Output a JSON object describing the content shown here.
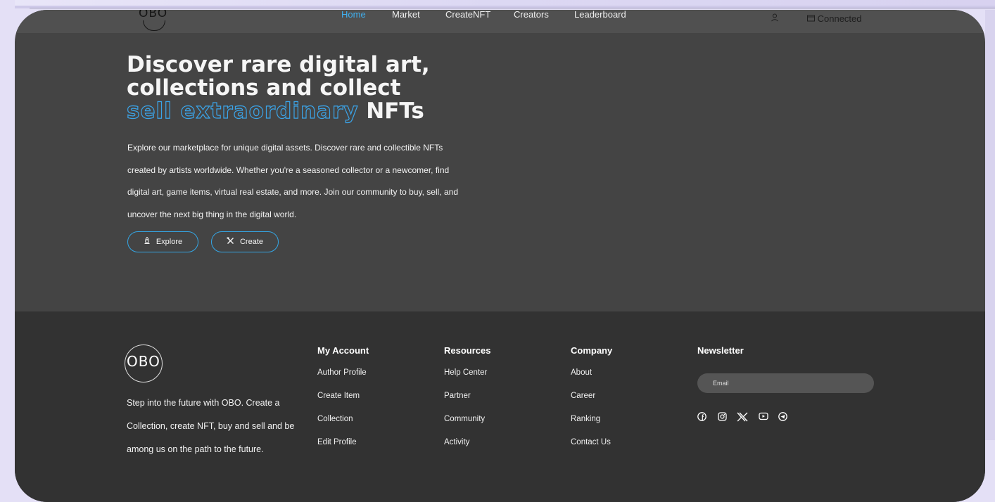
{
  "brand": {
    "logo": "OBO"
  },
  "nav": {
    "items": [
      {
        "label": "Home",
        "active": true
      },
      {
        "label": "Market",
        "active": false
      },
      {
        "label": "CreateNFT",
        "active": false
      },
      {
        "label": "Creators",
        "active": false
      },
      {
        "label": "Leaderboard",
        "active": false
      }
    ],
    "status": "Connected",
    "user_icon": "user-icon",
    "wallet_icon": "wallet-icon"
  },
  "hero": {
    "title_line1": "Discover rare digital art,",
    "title_line2": "collections and collect",
    "title_outline": "sell extraordinary",
    "title_end": "NFTs",
    "description_lines": [
      "Explore our marketplace for unique digital assets. Discover rare and collectible NFTs",
      "created by artists worldwide. Whether you're a seasoned collector or a newcomer, find",
      "digital art, game items, virtual real estate, and more. Join our community to buy, sell, and",
      "uncover the next big thing in the digital world."
    ],
    "buttons": {
      "explore": {
        "label": "Explore",
        "icon": "rocket-icon"
      },
      "create": {
        "label": "Create",
        "icon": "tools-icon"
      }
    }
  },
  "footer": {
    "logo": "OBO",
    "description_lines": [
      "Step into the future with OBO. Create a",
      "Collection, create NFT, buy and sell and be",
      "among us on the path to the future."
    ],
    "columns": [
      {
        "heading": "My Account",
        "links": [
          "Author Profile",
          "Create Item",
          "Collection",
          "Edit Profile"
        ]
      },
      {
        "heading": "Resources",
        "links": [
          "Help Center",
          "Partner",
          "Community",
          "Activity"
        ]
      },
      {
        "heading": "Company",
        "links": [
          "About",
          "Career",
          "Ranking",
          "Contact Us"
        ]
      }
    ],
    "newsletter": {
      "heading": "Newsletter",
      "email_placeholder": "Email",
      "social": [
        "facebook-icon",
        "instagram-icon",
        "x-icon",
        "youtube-icon",
        "telegram-icon"
      ]
    }
  },
  "colors": {
    "accent": "#3fb0f0",
    "hero_bg": "#444444",
    "footer_bg": "#323232"
  }
}
